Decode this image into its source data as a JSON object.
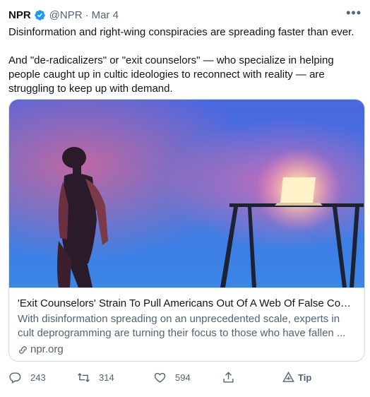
{
  "author": {
    "name": "NPR",
    "handle": "@NPR",
    "separator": "·",
    "date": "Mar 4",
    "verified_icon": "verified-badge-icon",
    "more_icon": "more-icon"
  },
  "tweet": {
    "paragraphs": [
      "Disinformation and right-wing conspiracies are spreading faster than ever.",
      "And \"de-radicalizers\" or \"exit counselors\" — who specialize in helping people caught up in cultic ideologies to reconnect with reality — are struggling to keep up with demand."
    ]
  },
  "card": {
    "title": "'Exit Counselors' Strain To Pull Americans Out Of A Web Of False Consp...",
    "description": "With disinformation spreading on an unprecedented scale, experts in cult deprogramming are turning their focus to those who have fallen ...",
    "domain": "npr.org",
    "link_icon": "link-icon"
  },
  "actions": {
    "reply_count": "243",
    "retweet_count": "314",
    "like_count": "594",
    "tip_label": "Tip",
    "icons": [
      "reply-icon",
      "retweet-icon",
      "like-icon",
      "share-icon",
      "tip-icon"
    ]
  },
  "colors": {
    "accent": "#1d9bf0",
    "text": "#0f1419",
    "secondary": "#536471",
    "border": "#cfd9de"
  }
}
